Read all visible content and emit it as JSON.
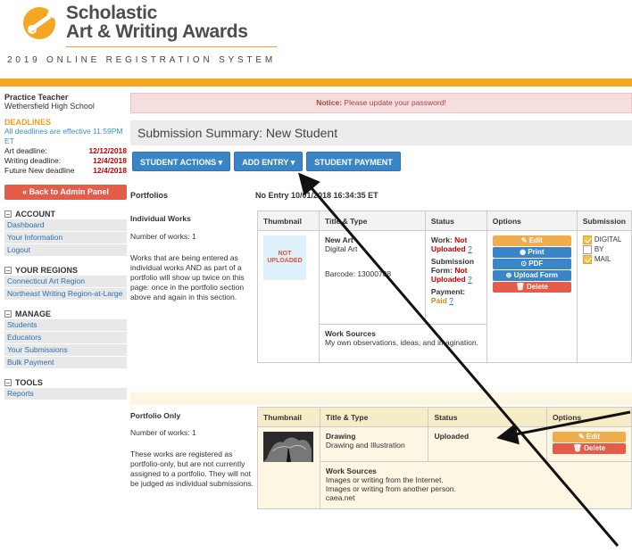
{
  "header": {
    "logo_line1": "Scholastic",
    "logo_line2": "Art & Writing Awards",
    "registration": "2019 ONLINE REGISTRATION SYSTEM"
  },
  "sidebar": {
    "teacher": "Practice Teacher",
    "school": "Wethersfield High School",
    "deadlines_title": "DEADLINES",
    "deadlines_note": "All deadlines are effective 11:59PM ET",
    "deadlines": [
      {
        "label": "Art deadline:",
        "date": "12/12/2018"
      },
      {
        "label": "Writing deadline:",
        "date": "12/4/2018"
      },
      {
        "label": "Future New deadline",
        "date": "12/4/2018"
      }
    ],
    "back": "« Back to Admin Panel",
    "sections": [
      {
        "title": "ACCOUNT",
        "items": [
          "Dashboard",
          "Your Information",
          "Logout"
        ]
      },
      {
        "title": "YOUR REGIONS",
        "items": [
          "Connecticut Art Region",
          "Northeast Writing Region-at-Large"
        ]
      },
      {
        "title": "MANAGE",
        "items": [
          "Students",
          "Educators",
          "Your Submissions",
          "Bulk Payment"
        ]
      },
      {
        "title": "TOOLS",
        "items": [
          "Reports"
        ]
      }
    ]
  },
  "main": {
    "notice_label": "Notice:",
    "notice_text": "Please update your password!",
    "title": "Submission Summary: New Student",
    "buttons": [
      "STUDENT ACTIONS",
      "ADD ENTRY",
      "STUDENT PAYMENT"
    ],
    "portfolios": "Portfolios",
    "no_entry": "No Entry 10/01/2018 16:34:35 ET",
    "individual": {
      "title": "Individual Works",
      "count": "Number of works: 1",
      "desc": "Works that are being entered as individual works AND as part of a portfolio will show up twice on this page: once in the portfolio section above and again in this section."
    },
    "table1": {
      "headers": [
        "Thumbnail",
        "Title & Type",
        "Status",
        "Options",
        "Submission"
      ],
      "thumb": "NOT UPLOADED",
      "title": "New Art",
      "type": "Digital Art",
      "barcode": "Barcode: 13000788",
      "work_label": "Work:",
      "work_status": "Not Uploaded",
      "q": "?",
      "form_label": "Submission Form:",
      "form_status": "Not Uploaded",
      "pay_label": "Payment:",
      "pay_status": "Paid",
      "options": [
        "Edit",
        "Print",
        "PDF",
        "Upload Form",
        "Delete"
      ],
      "submission": [
        "DIGITAL",
        "BY",
        "MAIL"
      ],
      "sources_title": "Work Sources",
      "sources": "My own observations, ideas, and imagination."
    },
    "portfolio_only": {
      "title": "Portfolio Only",
      "count": "Number of works: 1",
      "desc": "These works are registered as portfolio-only, but are not currently assigned to a portfolio. They will not be judged as individual submissions."
    },
    "table2": {
      "headers": [
        "Thumbnail",
        "Title & Type",
        "Status",
        "Options"
      ],
      "title": "Drawing",
      "type": "Drawing and Illustration",
      "status": "Uploaded",
      "options": [
        "Edit",
        "Delete"
      ],
      "sources_title": "Work Sources",
      "sources": [
        "Images or writing from the Internet.",
        "Images or writing from another person.",
        "caea.net"
      ]
    }
  }
}
